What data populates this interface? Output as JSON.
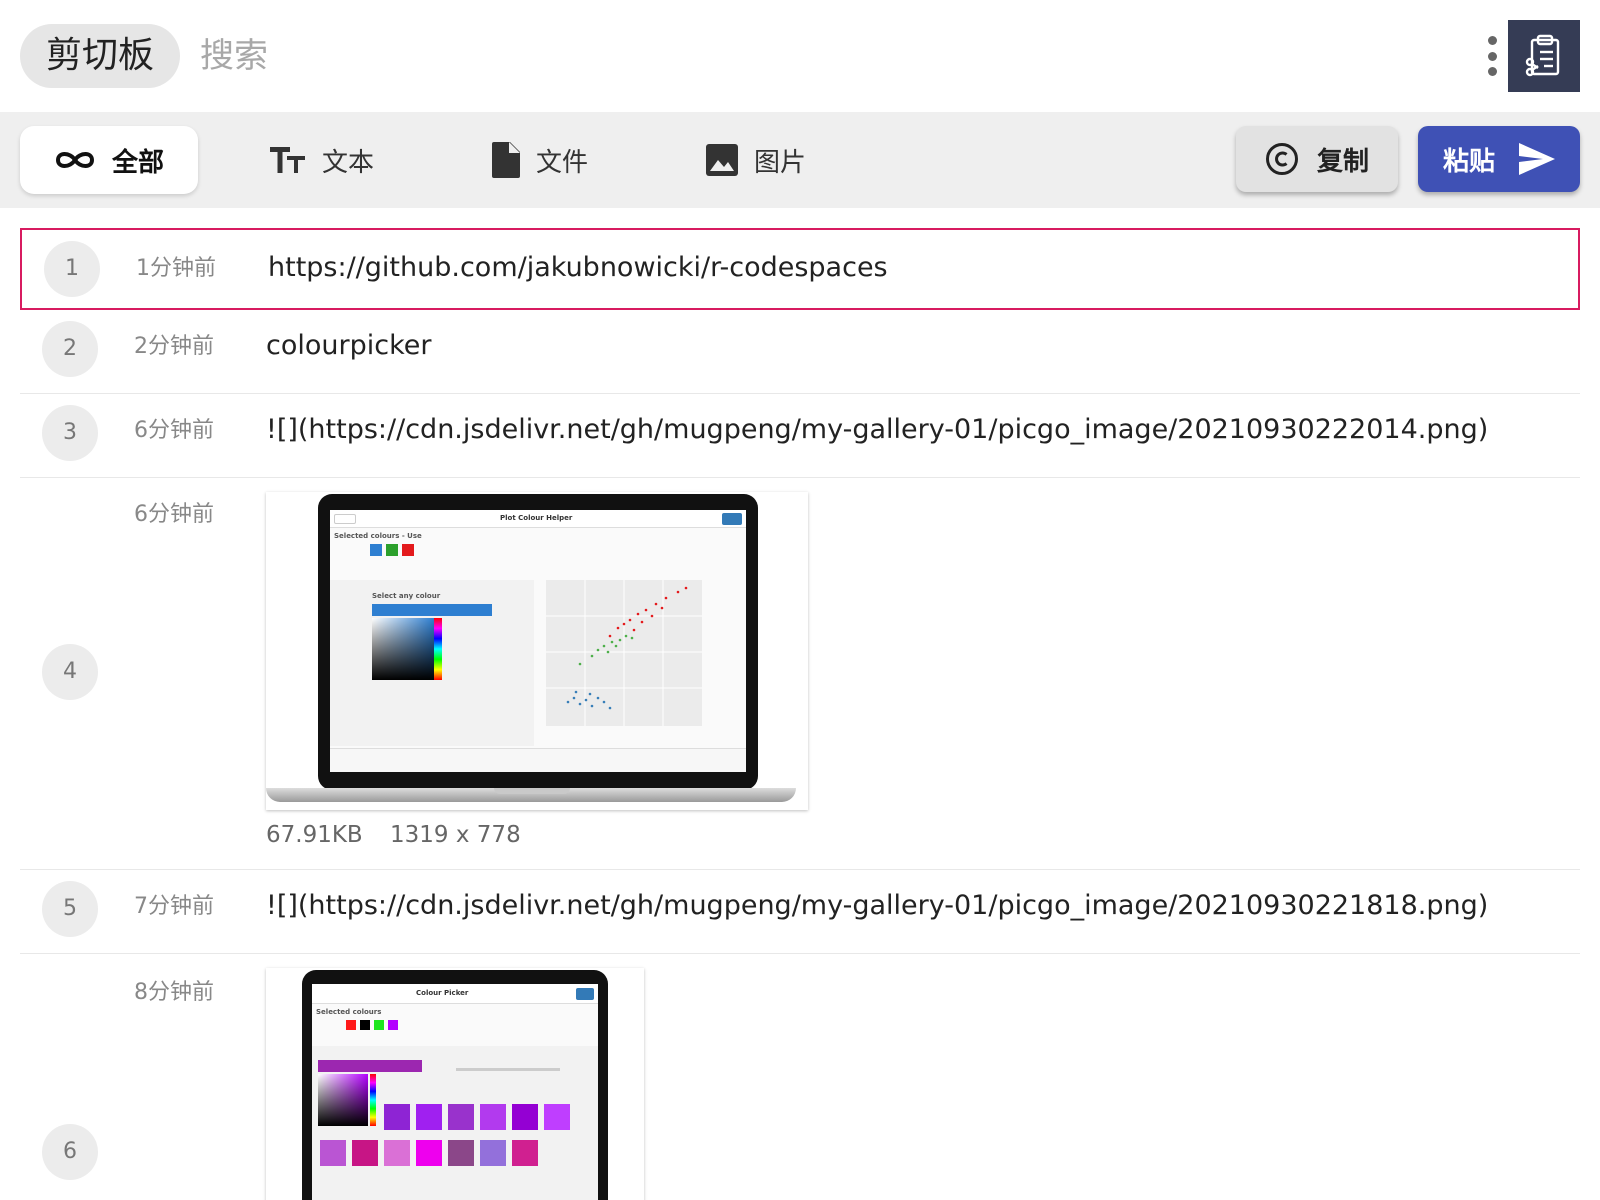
{
  "header": {
    "title": "剪切板",
    "search_placeholder": "搜索",
    "more_icon": "more-vertical-icon",
    "app_icon": "clipboard-cut-icon"
  },
  "toolbar": {
    "tabs": [
      {
        "label": "全部",
        "icon": "infinity-icon",
        "active": true
      },
      {
        "label": "文本",
        "icon": "text-size-icon",
        "active": false
      },
      {
        "label": "文件",
        "icon": "file-icon",
        "active": false
      },
      {
        "label": "图片",
        "icon": "image-icon",
        "active": false
      }
    ],
    "copy_label": "复制",
    "paste_label": "粘贴"
  },
  "colors": {
    "accent": "#3f51b5",
    "selected_border": "#d81b60",
    "app_icon_bg": "#353c55"
  },
  "items": [
    {
      "index": "1",
      "time": "1分钟前",
      "type": "text",
      "content": "https://github.com/jakubnowicki/r-codespaces",
      "selected": true
    },
    {
      "index": "2",
      "time": "2分钟前",
      "type": "text",
      "content": "colourpicker"
    },
    {
      "index": "3",
      "time": "6分钟前",
      "type": "text",
      "content": "![](https://cdn.jsdelivr.net/gh/mugpeng/my-gallery-01/picgo_image/20210930222014.png)"
    },
    {
      "index": "4",
      "time": "6分钟前",
      "type": "image",
      "size": "67.91KB",
      "dimensions": "1319 x 778",
      "screen_title": "Plot Colour Helper",
      "screen_text": "Selected colours - Use",
      "picker_label": "Select any colour"
    },
    {
      "index": "5",
      "time": "7分钟前",
      "type": "text",
      "content": "![](https://cdn.jsdelivr.net/gh/mugpeng/my-gallery-01/picgo_image/20210930221818.png)"
    },
    {
      "index": "6",
      "time": "8分钟前",
      "type": "image",
      "screen_title": "Colour Picker",
      "screen_text": "Selected colours"
    }
  ]
}
